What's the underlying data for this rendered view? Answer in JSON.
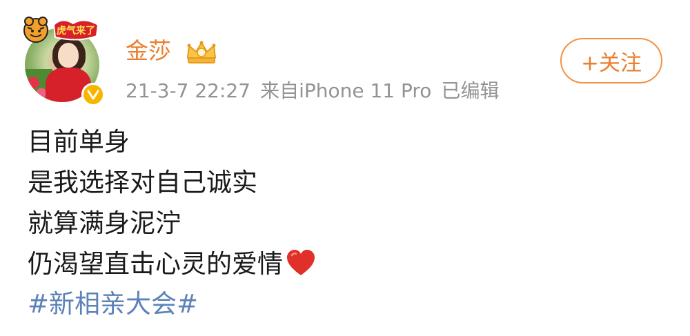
{
  "author": {
    "name": "金莎",
    "avatar_decoration_text": "虎气来了",
    "verified": true
  },
  "meta": {
    "time": "21-3-7 22:27",
    "source": "来自iPhone 11 Pro",
    "edited": "已编辑"
  },
  "follow_button": {
    "label": "+关注"
  },
  "content": {
    "lines": [
      "目前单身",
      "是我选择对自己诚实",
      "就算满身泥泞",
      "仍渴望直击心灵的爱情"
    ],
    "hashtag": "#新相亲大会#"
  },
  "colors": {
    "username": "#eb7d2e",
    "follow_border": "#f29144",
    "meta": "#939393",
    "hashtag": "#5d82b8",
    "heart": "#e0302a",
    "verified_badge": "#f7b500"
  },
  "icons": {
    "crown": "crown-icon",
    "verified": "verified-badge-icon",
    "heart": "red-heart-icon"
  }
}
